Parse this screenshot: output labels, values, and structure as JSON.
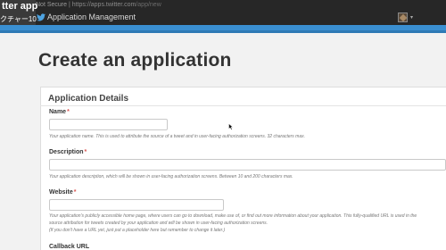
{
  "browser": {
    "insecure_label": "Not Secure",
    "url": "https://apps.twitter.com",
    "url_path": "/app/new"
  },
  "header": {
    "app_title": "Application Management"
  },
  "overlay": {
    "title": "tter app",
    "subtitle": "クチャー10"
  },
  "page": {
    "title": "Create an application"
  },
  "form": {
    "section_title": "Application Details",
    "required_marker": "*",
    "name": {
      "label": "Name",
      "value": "",
      "help": "Your application name. This is used to attribute the source of a tweet and in user-facing authorization screens. 32 characters max."
    },
    "description": {
      "label": "Description",
      "value": "",
      "help": "Your application description, which will be shown in user-facing authorization screens. Between 10 and 200 characters max."
    },
    "website": {
      "label": "Website",
      "value": "",
      "help_line1": "Your application's publicly accessible home page, where users can go to download, make use of, or find out more information about your application. This fully-qualified URL is used in the",
      "help_line2": "source attribution for tweets created by your application and will be shown in user-facing authorization screens.",
      "help_line3": "(If you don't have a URL yet, just put a placeholder here but remember to change it later.)"
    },
    "callback": {
      "label": "Callback URL"
    }
  },
  "colors": {
    "accent_blue": "#3a8fd1",
    "topbar": "#272727",
    "required": "#d9534f"
  },
  "icons": {
    "brand": "twitter-bird-icon",
    "account": "user-avatar-icon",
    "menu": "chevron-down-icon",
    "pointer": "mouse-cursor-icon"
  }
}
